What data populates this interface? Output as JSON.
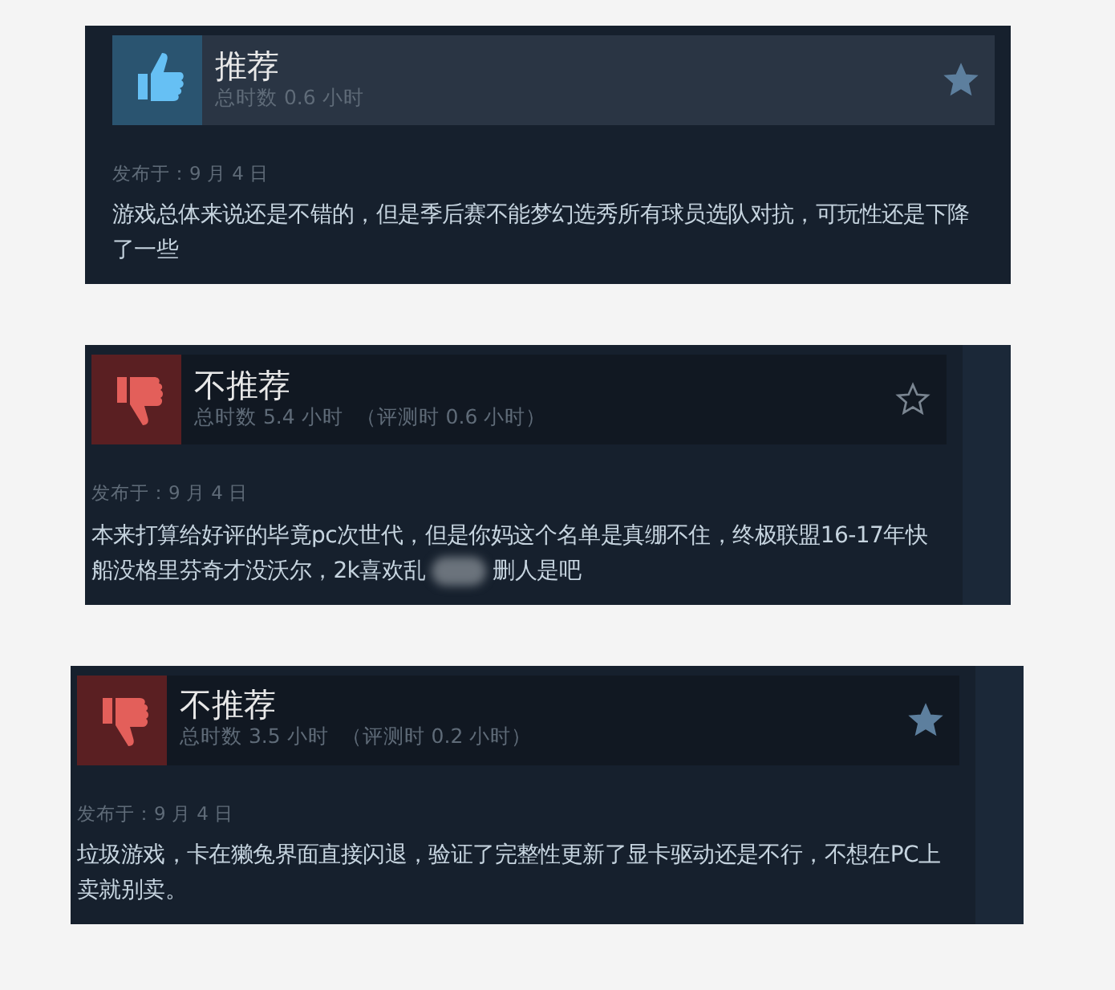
{
  "reviews": [
    {
      "kind": "positive",
      "title": "推荐",
      "playtime": "总时数 0.6 小时",
      "starred": true,
      "posted": "发布于：9 月 4 日",
      "body_parts": [
        "游戏总体来说还是不错的，但是季后赛不能梦幻选秀所有球员选队对抗，可玩性还是下降了一些"
      ],
      "side_strip": false
    },
    {
      "kind": "negative",
      "title": "不推荐",
      "playtime": "总时数 5.4 小时",
      "review_time": "（评测时 0.6 小时）",
      "starred": false,
      "posted": "发布于：9 月 4 日",
      "body_parts": [
        "本来打算给好评的毕竟pc次世代，但是你妈这个名单是真绷不住，终极联盟16-17年快船没格里芬奇才没沃尔，2k喜欢乱",
        "删人是吧"
      ],
      "side_strip": true
    },
    {
      "kind": "negative",
      "title": "不推荐",
      "playtime": "总时数 3.5 小时",
      "review_time": "（评测时 0.2 小时）",
      "starred": true,
      "posted": "发布于：9 月 4 日",
      "body_parts": [
        "垃圾游戏，卡在獭兔界面直接闪退，验证了完整性更新了显卡驱动还是不行，不想在PC上卖就别卖。"
      ],
      "side_strip": true
    }
  ]
}
